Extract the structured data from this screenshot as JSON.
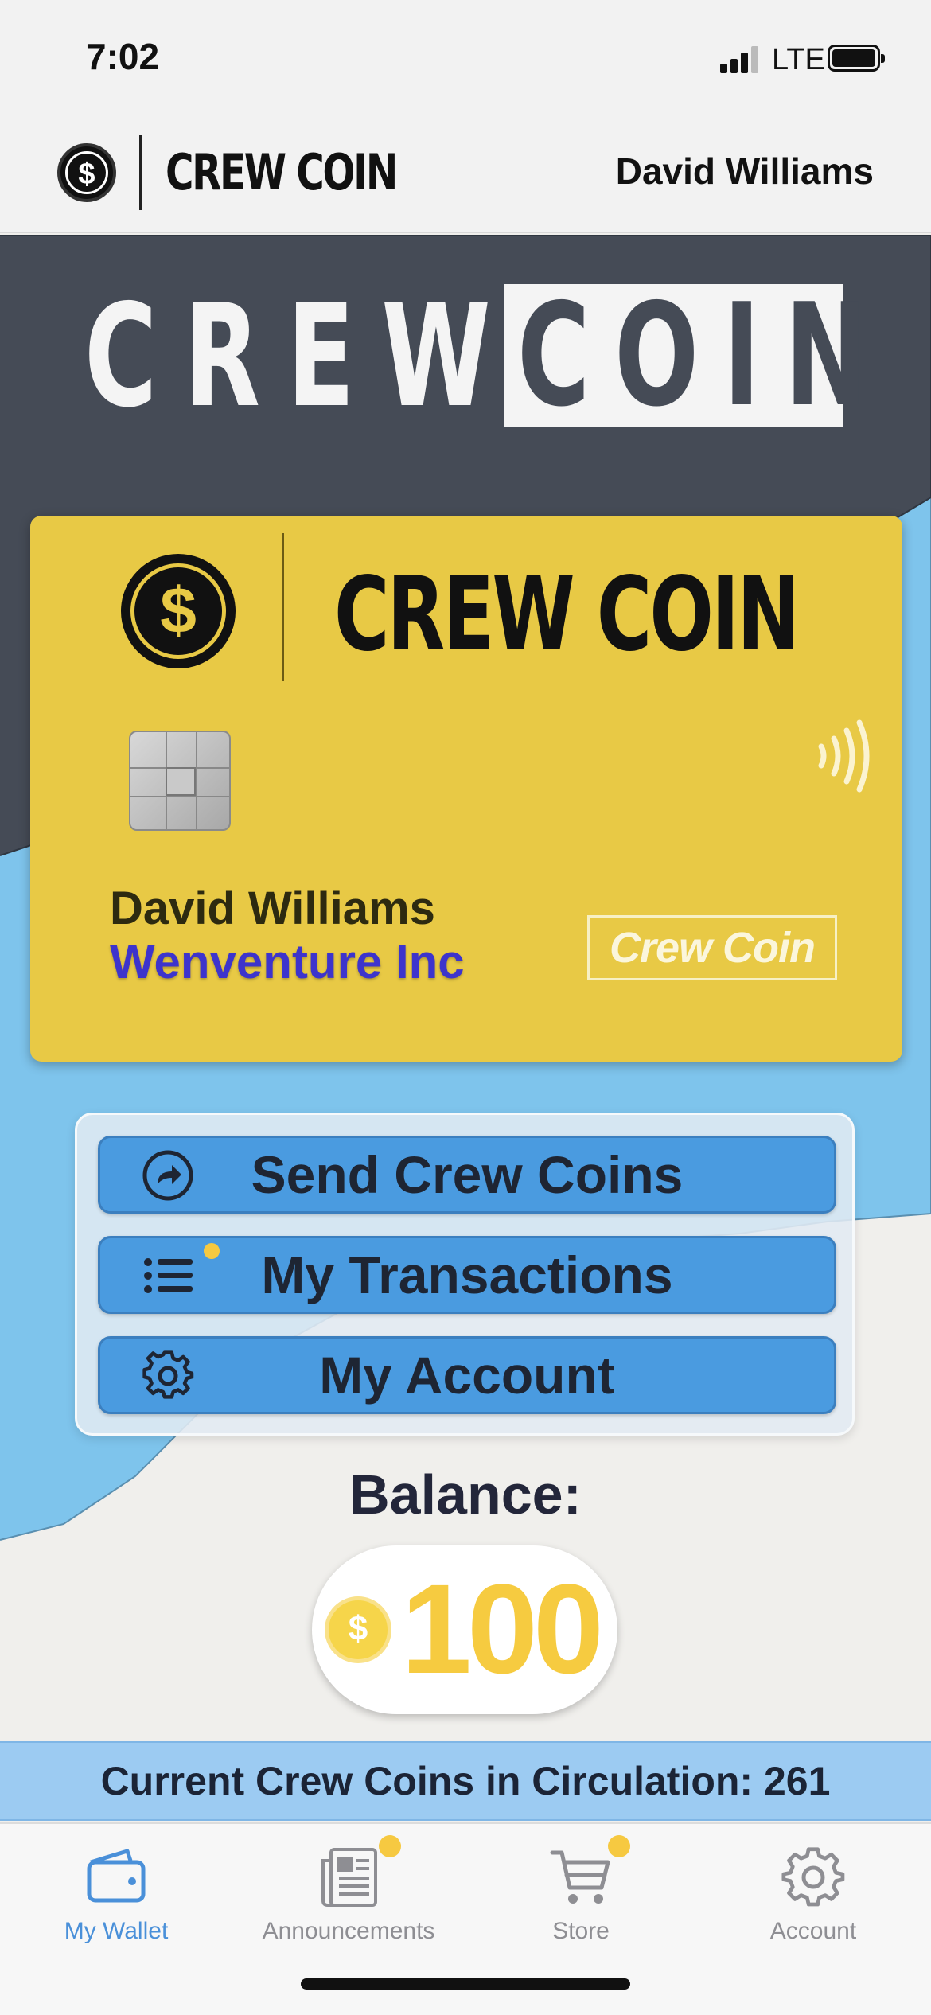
{
  "status_bar": {
    "time": "7:02",
    "network": "LTE",
    "icons": [
      "signal-icon",
      "battery-icon"
    ]
  },
  "header": {
    "brand": "CREW COIN",
    "user_name": "David Williams",
    "logo_icon": "dollar-coin-icon"
  },
  "banner": {
    "word1": "CREW",
    "word2": "COIN"
  },
  "card": {
    "brand": "CREW COIN",
    "holder_name": "David Williams",
    "company": "Wenventure Inc",
    "badge": "Crew Coin",
    "icons": [
      "dollar-coin-icon",
      "chip-icon",
      "contactless-icon"
    ]
  },
  "actions": [
    {
      "label": "Send Crew Coins",
      "icon": "send-arrow-icon",
      "notification": false
    },
    {
      "label": "My Transactions",
      "icon": "list-icon",
      "notification": true
    },
    {
      "label": "My Account",
      "icon": "gear-icon",
      "notification": false
    }
  ],
  "balance": {
    "label": "Balance:",
    "value": "100",
    "currency_symbol": "$"
  },
  "circulation": {
    "text": "Current Crew Coins in Circulation: 261"
  },
  "tabs": [
    {
      "label": "My Wallet",
      "icon": "wallet-icon",
      "active": true,
      "notification": false
    },
    {
      "label": "Announcements",
      "icon": "newspaper-icon",
      "active": false,
      "notification": true
    },
    {
      "label": "Store",
      "icon": "cart-icon",
      "active": false,
      "notification": true
    },
    {
      "label": "Account",
      "icon": "gear-icon",
      "active": false,
      "notification": false
    }
  ],
  "colors": {
    "accent_blue": "#4a9be0",
    "card_yellow": "#e8c945",
    "banner_dark": "#454b56",
    "light_blue": "#7dc4ec",
    "balance_gold": "#f6cb40",
    "notification_dot": "#f6c941",
    "company_text": "#3d34cc"
  }
}
